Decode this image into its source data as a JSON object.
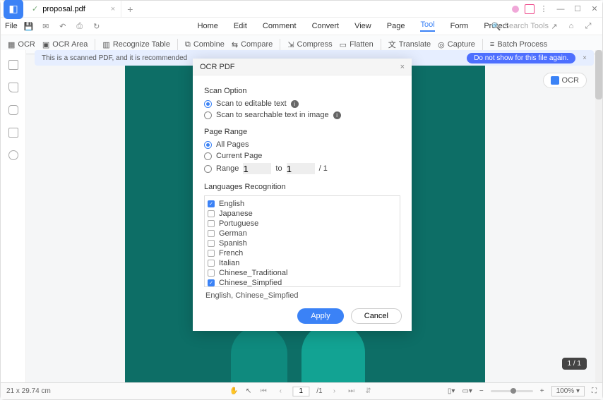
{
  "titlebar": {
    "filename": "proposal.pdf"
  },
  "file_menu": "File",
  "menu": {
    "items": [
      "Home",
      "Edit",
      "Comment",
      "Convert",
      "View",
      "Page",
      "Tool",
      "Form",
      "Protect"
    ],
    "active_index": 6,
    "search_placeholder": "Search Tools"
  },
  "ribbon": {
    "ocr": "OCR",
    "ocr_area": "OCR Area",
    "recognize_table": "Recognize Table",
    "combine": "Combine",
    "compare": "Compare",
    "compress": "Compress",
    "flatten": "Flatten",
    "translate": "Translate",
    "capture": "Capture",
    "batch": "Batch Process"
  },
  "banner": {
    "text": "This is a scanned PDF, and it is recommended",
    "btn": "Do not show for this file again."
  },
  "ocr_pill": "OCR",
  "page_badge": "1 / 1",
  "dialog": {
    "title": "OCR PDF",
    "scan_option_h": "Scan Option",
    "scan_opt1": "Scan to editable text",
    "scan_opt2": "Scan to searchable text in image",
    "page_range_h": "Page Range",
    "pr_all": "All Pages",
    "pr_current": "Current Page",
    "pr_range": "Range",
    "pr_from": "1",
    "pr_to_label": "to",
    "pr_to": "1",
    "pr_total": "/ 1",
    "lang_h": "Languages Recognition",
    "langs": [
      "English",
      "Japanese",
      "Portuguese",
      "German",
      "Spanish",
      "French",
      "Italian",
      "Chinese_Traditional",
      "Chinese_Simpfied"
    ],
    "lang_checked": [
      0,
      8
    ],
    "selected_text": "English,   Chinese_Simpfied",
    "apply": "Apply",
    "cancel": "Cancel"
  },
  "status": {
    "dims": "21 x 29.74 cm",
    "page_cur": "1",
    "page_total": "/1",
    "zoom": "100%"
  }
}
